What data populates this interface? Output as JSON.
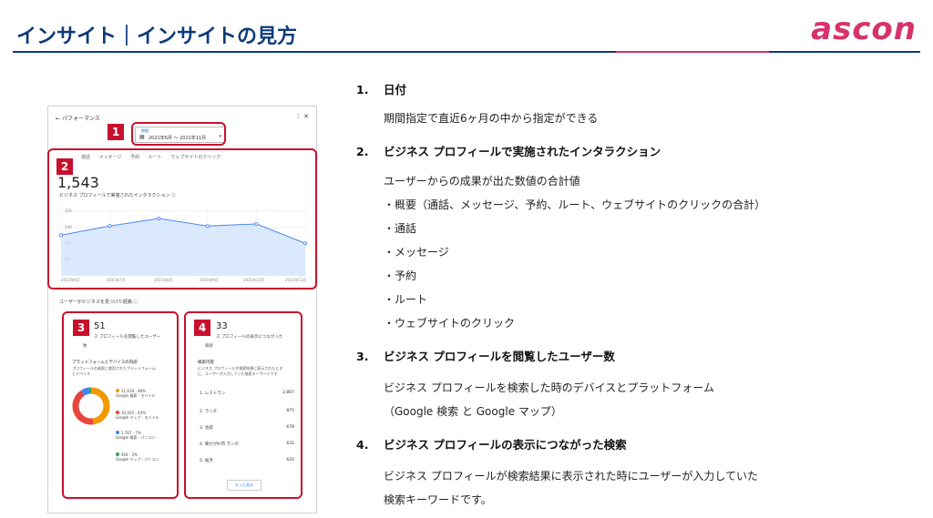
{
  "header": {
    "title": "インサイト｜インサイトの見方",
    "logo": "ascon"
  },
  "shot": {
    "header_title": "パフォーマンス",
    "icons": "⋮  ✕",
    "date_label": "期間",
    "date_value": "2021年6月 〜 2021年11月",
    "tabs": [
      "通話",
      "メッセージ",
      "予約",
      "ルート",
      "ウェブサイトのクリック"
    ],
    "total": "1,543",
    "total_caption": "ビジネス プロフィールで実施されたインタラクション",
    "y_ticks": [
      "320",
      "240",
      "160",
      "80"
    ],
    "x_ticks": [
      "2021年6月",
      "2021年7月",
      "2021年8月",
      "2021年9月",
      "2021年10月",
      "2021年11月"
    ],
    "section_title": "ユーザーがビジネスを見つけた経路",
    "card3": {
      "num": "51",
      "caption1": "ス プロフィールを閲覧したユーザー",
      "caption2": "数",
      "platform_title": "プラットフォームとデバイスの内訳",
      "platform_desc1": "プロフィールの検索に使用されたプラットフォーム",
      "platform_desc2": "とデバイス",
      "legend": [
        {
          "value": "11,618 - 48%",
          "label": "Google 検索 - モバイル",
          "color": "#f29900"
        },
        {
          "value": "10,450 - 43%",
          "label": "Google マップ - モバイル",
          "color": "#e8453c"
        },
        {
          "value": "1,767 - 7%",
          "label": "Google 検索 - パソコン",
          "color": "#4285f4"
        },
        {
          "value": "404 - 2%",
          "label": "Google マップ - パソコン",
          "color": "#34a853"
        }
      ]
    },
    "card4": {
      "num": "33",
      "caption1": "ス プロフィールの表示につながった",
      "caption2": "検索",
      "kw_title": "検索内容",
      "kw_desc1": "ビジネス プロフィールが検索結果に表示されたとき",
      "kw_desc2": "に、ユーザーが入力していた検索キーワードです",
      "keywords": [
        {
          "rank": "1.",
          "term": "レストラン",
          "count": "2,807"
        },
        {
          "rank": "2.",
          "term": "ランチ",
          "count": "875"
        },
        {
          "rank": "3.",
          "term": "池袋",
          "count": "678"
        },
        {
          "rank": "4.",
          "term": "東かがわ市 ランチ",
          "count": "631"
        },
        {
          "rank": "5.",
          "term": "長浜",
          "count": "620"
        }
      ],
      "more": "もっと見る"
    }
  },
  "badges": [
    "1",
    "2",
    "3",
    "4"
  ],
  "chart_data": {
    "type": "line",
    "x": [
      "2021年6月",
      "2021年7月",
      "2021年8月",
      "2021年9月",
      "2021年10月",
      "2021年11月"
    ],
    "values": [
      200,
      245,
      282,
      245,
      255,
      160
    ],
    "ylim": [
      0,
      340
    ],
    "y_ticks": [
      80,
      160,
      240,
      320
    ],
    "grid": true
  },
  "items": [
    {
      "num": "1.",
      "heading": "日付",
      "lines": [
        "期間指定で直近6ヶ月の中から指定ができる"
      ]
    },
    {
      "num": "2.",
      "heading": "ビジネス プロフィールで実施されたインタラクション",
      "lines": [
        "ユーザーからの成果が出た数値の合計値",
        "・概要（通話、メッセージ、予約、ルート、ウェブサイトのクリックの合計）",
        "・通話",
        "・メッセージ",
        "・予約",
        "・ルート",
        "・ウェブサイトのクリック"
      ]
    },
    {
      "num": "3.",
      "heading": "ビジネス プロフィールを閲覧したユーザー数",
      "lines": [
        "ビジネス プロフィールを検索した時のデバイスとプラットフォーム",
        "（Google 検索 と Google マップ）"
      ]
    },
    {
      "num": "4.",
      "heading": "ビジネス プロフィールの表示につながった検索",
      "lines": [
        "ビジネス プロフィールが検索結果に表示された時にユーザーが入力していた",
        "検索キーワードです。"
      ]
    }
  ]
}
